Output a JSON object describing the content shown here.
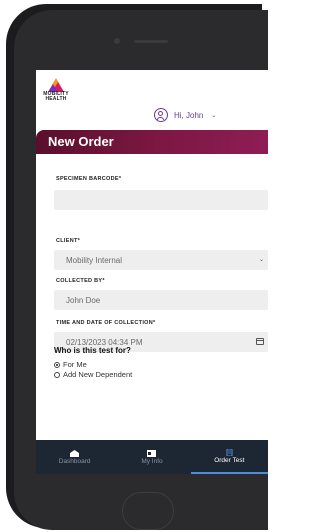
{
  "header": {
    "brand": "MOBILITY HEALTH",
    "greeting": "Hi, John"
  },
  "order": {
    "title": "New Order",
    "fields": {
      "specimen_barcode": {
        "label": "SPECIMEN BARCODE*",
        "value": ""
      },
      "client": {
        "label": "CLIENT*",
        "value": "Mobility Internal"
      },
      "collected_by": {
        "label": "COLLECTED BY*",
        "value": "John Doe"
      },
      "collection_time": {
        "label": "TIME AND DATE OF COLLECTION*",
        "value": "02/13/2023 04:34 PM"
      }
    },
    "question": "Who is this test for?",
    "options": {
      "for_me": "For Me",
      "add_dependent": "Add New Dependent"
    },
    "selected_option": "for_me"
  },
  "tabs": {
    "dashboard": "Dashboard",
    "my_info": "My Info",
    "order_test": "Order Test",
    "active": "order_test"
  },
  "colors": {
    "header_gradient_start": "#5a0f2c",
    "header_gradient_end": "#8e1d55",
    "accent_purple": "#6b3a9c",
    "tabbar_bg": "#1d2633",
    "tab_active_underline": "#4a8dde"
  },
  "icons": {
    "user": "user-circle-icon",
    "calendar": "calendar-icon",
    "dropdown": "chevron-down-icon",
    "dashboard": "dashboard-icon",
    "my_info": "id-card-icon",
    "order_test": "order-list-icon"
  }
}
